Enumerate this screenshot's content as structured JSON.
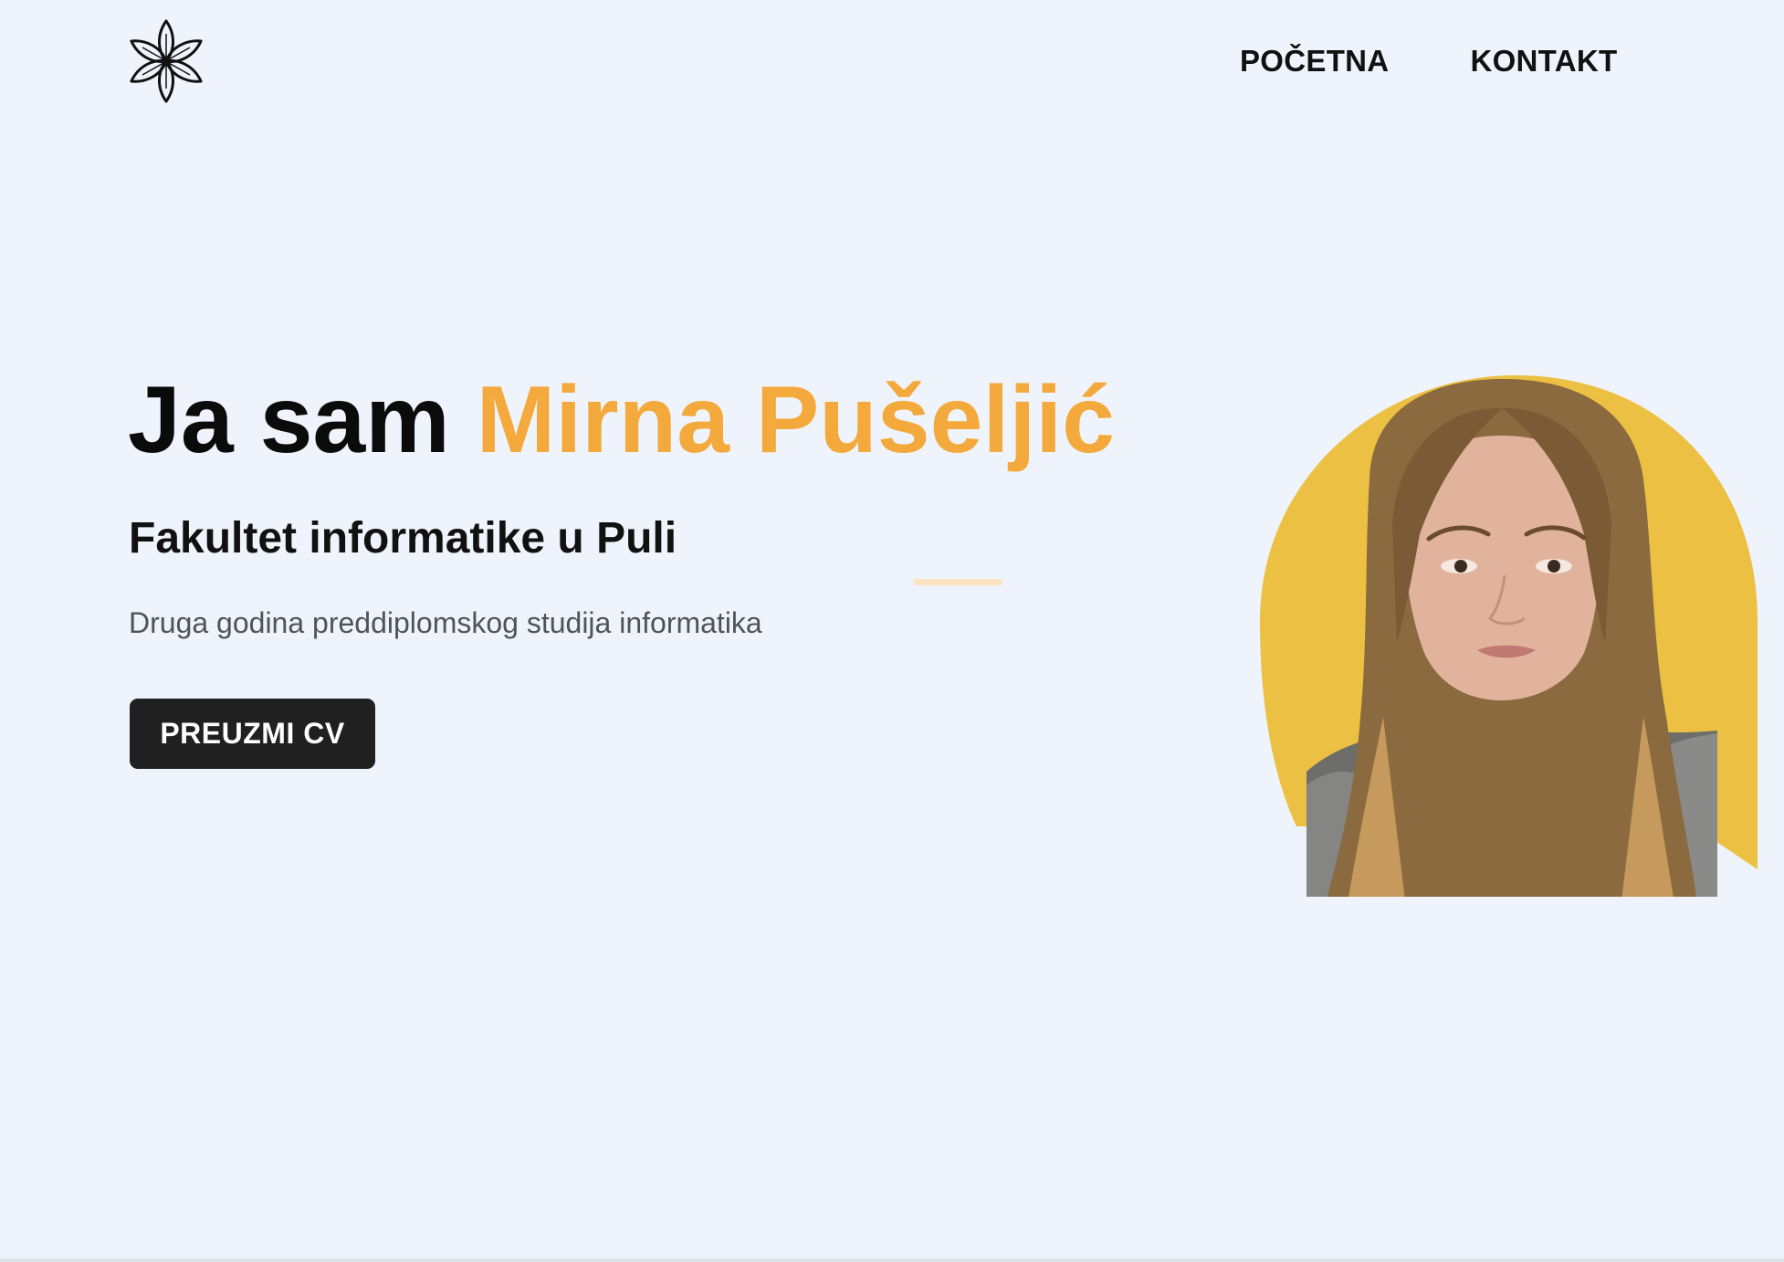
{
  "header": {
    "logo": "flower-logo-icon",
    "nav": [
      {
        "label": "POČETNA"
      },
      {
        "label": "KONTAKT"
      }
    ]
  },
  "hero": {
    "title_prefix": "Ja sam ",
    "title_name": "Mirna Pušeljić",
    "subtitle": "Fakultet informatike u Puli",
    "description": "Druga godina preddiplomskog studija informatika",
    "button_label": "PREUZMI CV"
  },
  "colors": {
    "background": "#eff4fc",
    "accent": "#f3a93b",
    "portrait_backdrop": "#ecc043",
    "button": "#202020",
    "accent_bar": "#fbe3c1"
  }
}
